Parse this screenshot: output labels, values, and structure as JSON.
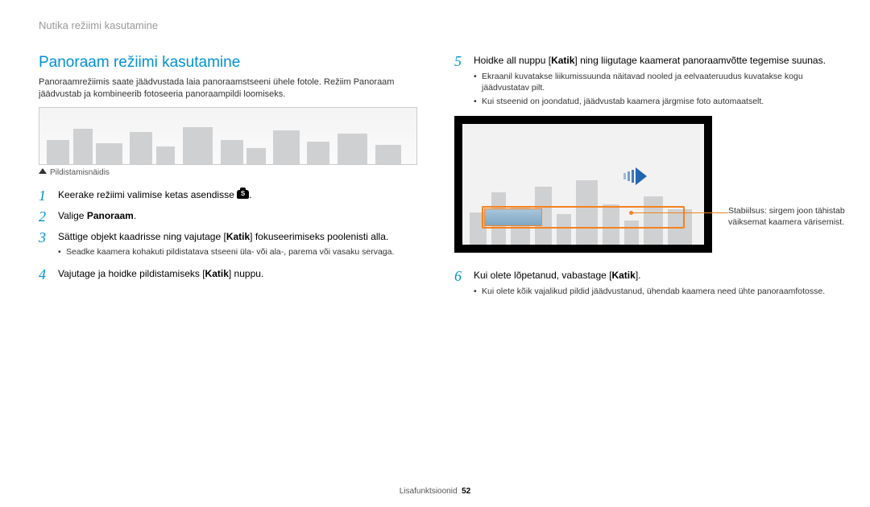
{
  "running_head": "Nutika režiimi kasutamine",
  "section_title": "Panoraam režiimi kasutamine",
  "intro": "Panoraamrežiimis saate jäädvustada laia panoraamstseeni ühele fotole. Režiim Panoraam jäädvustab ja kombineerib fotoseeria panoraampildi loomiseks.",
  "example_caption": "Pildistamisnäidis",
  "steps_left": [
    {
      "num": "1",
      "html": "Keerake režiimi valimise ketas asendisse {MODE_S}."
    },
    {
      "num": "2",
      "html": "Valige <strong>Panoraam</strong>."
    },
    {
      "num": "3",
      "html": "Sättige objekt kaadrisse ning vajutage [<strong>Katik</strong>] fokuseerimiseks poolenisti alla.",
      "sub": [
        "Seadke kaamera kohakuti pildistatava stseeni üla- või ala-, parema või vasaku servaga."
      ]
    },
    {
      "num": "4",
      "html": "Vajutage ja hoidke pildistamiseks [<strong>Katik</strong>] nuppu."
    }
  ],
  "steps_right": [
    {
      "num": "5",
      "html": "Hoidke all nuppu [<strong>Katik</strong>] ning liigutage kaamerat panoraamvõtte tegemise suunas.",
      "sub": [
        "Ekraanil kuvatakse liikumissuunda näitavad nooled ja eelvaateruudus kuvatakse kogu jäädvustatav pilt.",
        "Kui stseenid on joondatud, jäädvustab kaamera järgmise foto automaatselt."
      ]
    },
    {
      "num": "6",
      "html": "Kui olete lõpetanud, vabastage [<strong>Katik</strong>].",
      "sub": [
        "Kui olete kõik vajalikud pildid jäädvustanud, ühendab kaamera need ühte panoraamfotosse."
      ]
    }
  ],
  "callout": "Stabiilsus: sirgem joon tähistab väiksemat kaamera värisemist.",
  "footer_section": "Lisafunktsioonid",
  "page_number": "52"
}
